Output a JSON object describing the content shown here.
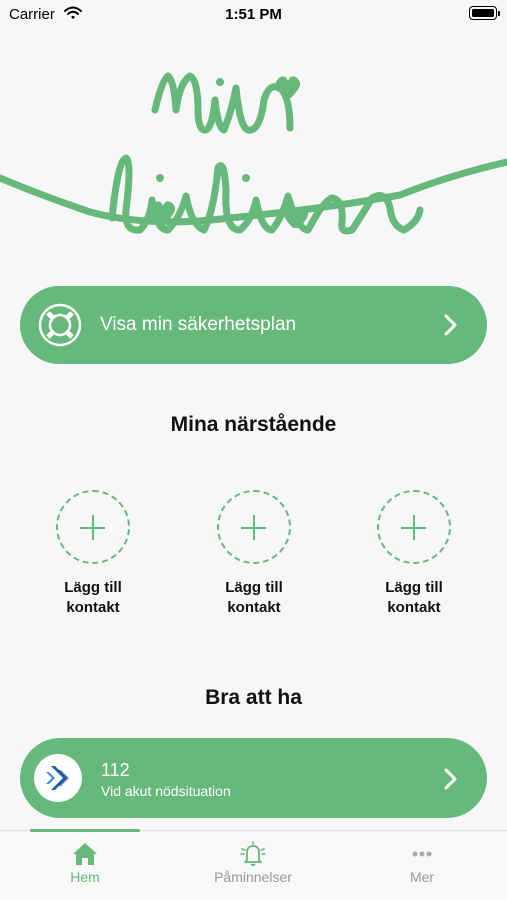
{
  "status_bar": {
    "carrier": "Carrier",
    "time": "1:51 PM"
  },
  "logo": {
    "text_line1": "Min",
    "text_line2": "livlina"
  },
  "safety_plan": {
    "label": "Visa min säkerhetsplan"
  },
  "relatives": {
    "title": "Mina närstående",
    "contacts": [
      {
        "line1": "Lägg till",
        "line2": "kontakt"
      },
      {
        "line1": "Lägg till",
        "line2": "kontakt"
      },
      {
        "line1": "Lägg till",
        "line2": "kontakt"
      }
    ]
  },
  "good_to_have": {
    "title": "Bra att ha",
    "items": [
      {
        "title": "112",
        "subtitle": "Vid akut nödsituation"
      }
    ]
  },
  "tabbar": {
    "tabs": [
      {
        "label": "Hem",
        "icon": "home-icon",
        "active": true
      },
      {
        "label": "Påminnelser",
        "icon": "bell-icon",
        "active": false
      },
      {
        "label": "Mer",
        "icon": "more-icon",
        "active": false
      }
    ]
  },
  "colors": {
    "accent": "#66b97a",
    "background": "#f7f7f8",
    "inactive": "#999999"
  }
}
